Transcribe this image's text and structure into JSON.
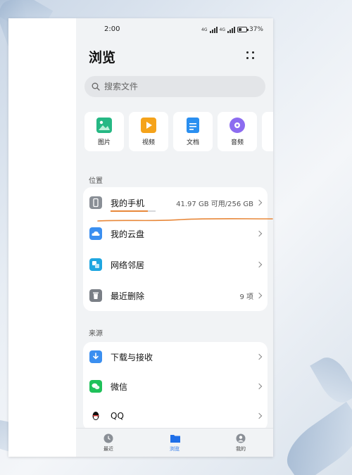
{
  "status_bar": {
    "time": "2:00",
    "battery": "37%",
    "signal_a": "4G",
    "signal_b": "4G"
  },
  "header": {
    "title": "浏览"
  },
  "search": {
    "placeholder": "搜索文件"
  },
  "categories": [
    {
      "label": "图片",
      "icon": "image-icon",
      "color": "#26b884"
    },
    {
      "label": "视频",
      "icon": "video-icon",
      "color": "#f5a31b"
    },
    {
      "label": "文档",
      "icon": "document-icon",
      "color": "#2a8ff0"
    },
    {
      "label": "音频",
      "icon": "audio-icon",
      "color": "#8c6cf0"
    }
  ],
  "location": {
    "section_label": "位置",
    "items": [
      {
        "label": "我的手机",
        "value": "41.97 GB 可用/256 GB",
        "icon": "phone-icon",
        "color": "#8a8f96"
      },
      {
        "label": "我的云盘",
        "value": "",
        "icon": "cloud-icon",
        "color": "#3b8ff0"
      },
      {
        "label": "网络邻居",
        "value": "",
        "icon": "network-icon",
        "color": "#1fa6e0"
      },
      {
        "label": "最近删除",
        "value": "9 项",
        "icon": "trash-icon",
        "color": "#7a7f86"
      }
    ]
  },
  "source": {
    "section_label": "来源",
    "items": [
      {
        "label": "下载与接收",
        "icon": "download-icon",
        "color": "#3b8ff0"
      },
      {
        "label": "微信",
        "icon": "wechat-icon",
        "color": "#1fc15a"
      },
      {
        "label": "QQ",
        "icon": "qq-icon",
        "color": "#111111"
      }
    ]
  },
  "bottom_nav": [
    {
      "label": "最近",
      "icon": "clock-icon",
      "active": false
    },
    {
      "label": "浏览",
      "icon": "folder-icon",
      "active": true
    },
    {
      "label": "我的",
      "icon": "profile-icon",
      "active": false
    }
  ],
  "colors": {
    "accent": "#1f6fe8",
    "annotation": "#e8883a"
  }
}
